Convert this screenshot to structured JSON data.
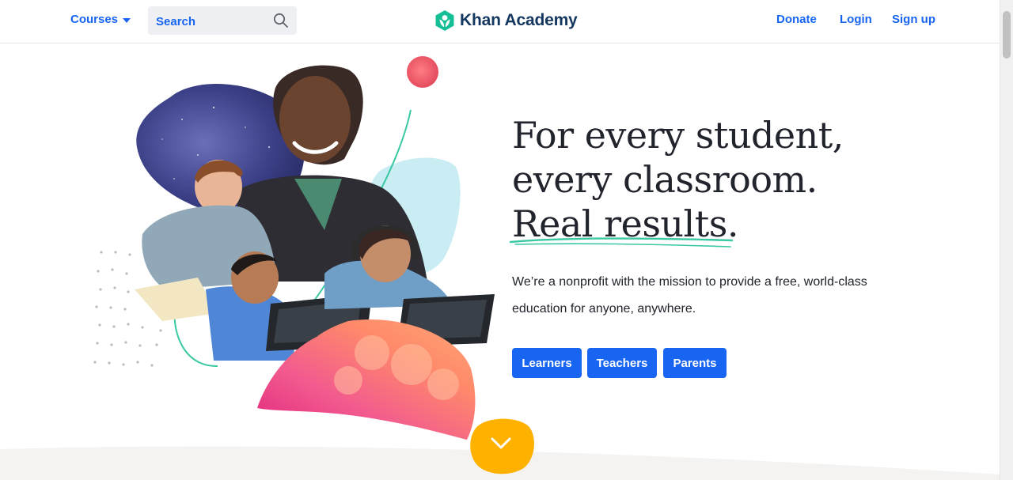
{
  "header": {
    "courses_label": "Courses",
    "search_placeholder": "Search",
    "logo_text": "Khan Academy",
    "nav": {
      "donate": "Donate",
      "login": "Login",
      "signup": "Sign up"
    }
  },
  "hero": {
    "headline": [
      "For every student,",
      "every classroom.",
      "Real results."
    ],
    "subcopy": "We’re a nonprofit with the mission to provide a free, world-class education for anyone, anywhere.",
    "buttons": {
      "learners": "Learners",
      "teachers": "Teachers",
      "parents": "Parents"
    }
  },
  "colors": {
    "brand_blue": "#1865f2",
    "logo_green": "#14bf96",
    "logo_navy": "#14375f",
    "text_dark": "#21242c",
    "accent_yellow": "#ffb100",
    "accent_teal": "#3ac9a3"
  },
  "icons": [
    "chevron-down-icon",
    "search-icon",
    "khan-logo-icon",
    "scroll-down-chevron-icon"
  ]
}
